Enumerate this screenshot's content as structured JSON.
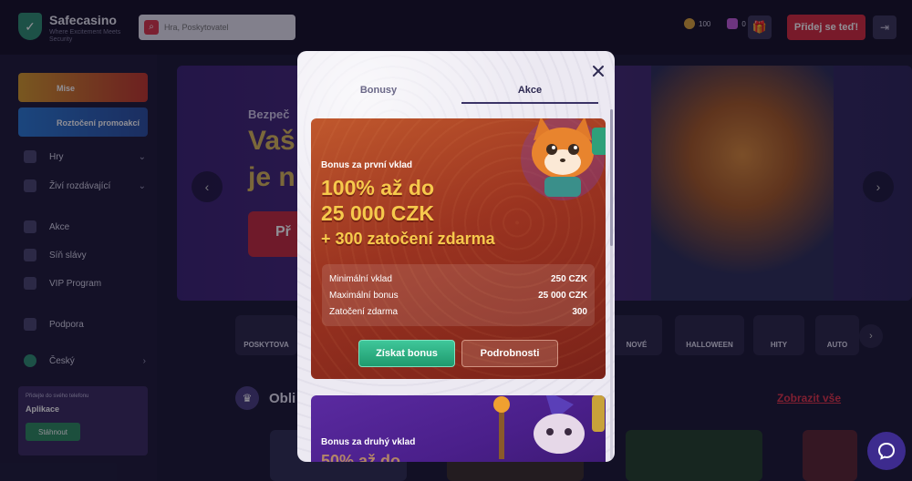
{
  "header": {
    "logo_name": "Safecasino",
    "logo_tagline": "Where Excitement Meets Security",
    "search_placeholder": "Hra, Poskytovatel",
    "coins": "100",
    "gems": "0",
    "deposit_label": "Přidej se teď!"
  },
  "sidebar": {
    "banner_mise": "Mise",
    "banner_promo": "Roztočení promoakcí",
    "items": [
      {
        "label": "Hry",
        "icon": "slot-icon"
      },
      {
        "label": "Živí rozdávající",
        "icon": "cards-icon"
      },
      {
        "label": "Akce",
        "icon": "megaphone-icon"
      },
      {
        "label": "Síň slávy",
        "icon": "trophy-icon"
      },
      {
        "label": "VIP Program",
        "icon": "crown-icon"
      },
      {
        "label": "Podpora",
        "icon": "support-icon"
      },
      {
        "label": "Český",
        "icon": "globe-icon"
      }
    ],
    "app": {
      "small": "Přidejte do svého telefonu",
      "title": "Aplikace",
      "button": "Stáhnout"
    }
  },
  "hero": {
    "small": "Bezpeč",
    "line1": "Vaš",
    "line2": "je n",
    "button": "Př"
  },
  "categories": [
    "POSKYTOVA",
    "NOVÉ",
    "HALLOWEEN",
    "HITY",
    "AUTO"
  ],
  "section": {
    "title": "Obli",
    "show_all": "Zobrazit vše"
  },
  "modal": {
    "tabs": [
      {
        "label": "Bonusy",
        "active": false
      },
      {
        "label": "Akce",
        "active": true
      }
    ],
    "card1": {
      "subtitle": "Bonus za první vklad",
      "headline_1": "100% až do",
      "headline_2": "25 000 CZK",
      "headline_3": "+ 300 zatočení zdarma",
      "rows": [
        {
          "label": "Minimální vklad",
          "value": "250 CZK"
        },
        {
          "label": "Maximální bonus",
          "value": "25 000 CZK"
        },
        {
          "label": "Zatočení zdarma",
          "value": "300"
        }
      ],
      "claim_label": "Získat bonus",
      "details_label": "Podrobnosti"
    },
    "card2": {
      "subtitle": "Bonus za druhý vklad",
      "headline_partial": "50% až do"
    }
  },
  "colors": {
    "accent_red": "#d42a3c",
    "claim_green": "#1f9a6e",
    "headline_gold": "#f6c94c",
    "modal_bg": "#ece9f2"
  }
}
